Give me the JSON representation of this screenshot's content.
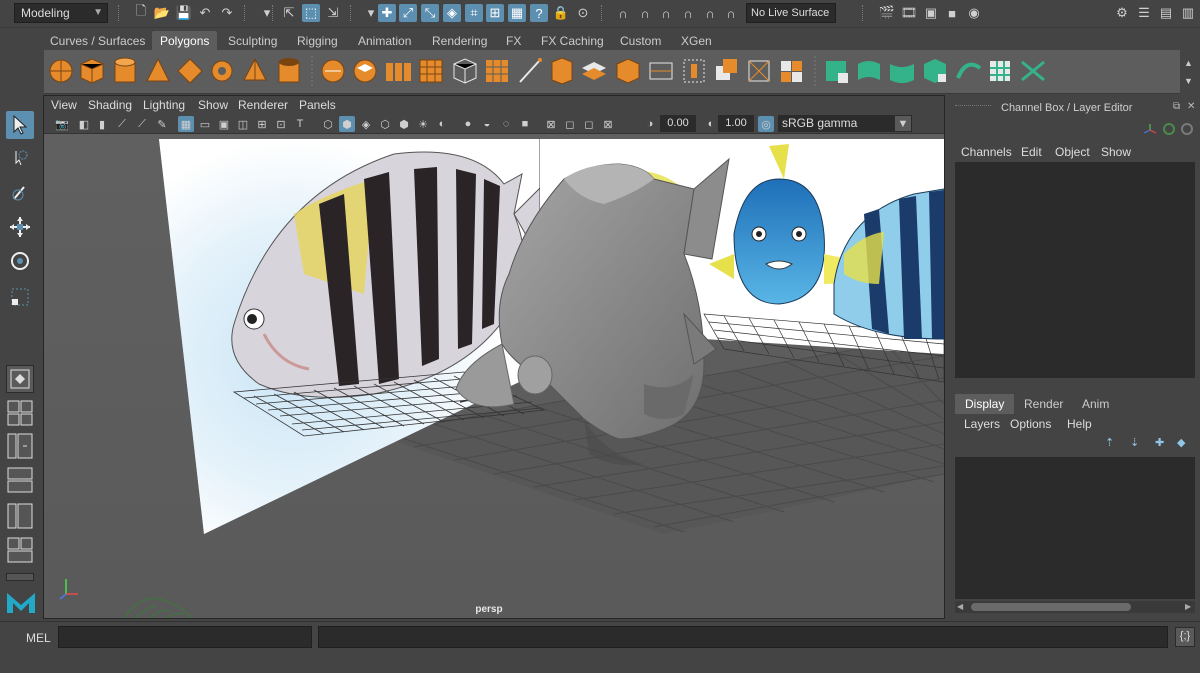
{
  "status_line": {
    "mode": "Modeling",
    "live_surface": "No Live Surface"
  },
  "shelf": {
    "tabs": [
      "Curves / Surfaces",
      "Polygons",
      "Sculpting",
      "Rigging",
      "Animation",
      "Rendering",
      "FX",
      "FX Caching",
      "Custom",
      "XGen"
    ],
    "active_tab": "Polygons"
  },
  "viewport": {
    "menus": [
      "View",
      "Shading",
      "Lighting",
      "Show",
      "Renderer",
      "Panels"
    ],
    "exposure": "0.00",
    "gamma": "1.00",
    "color_space": "sRGB gamma",
    "camera_label": "persp"
  },
  "channel_box": {
    "title": "Channel Box / Layer Editor",
    "menus": [
      "Channels",
      "Edit",
      "Object",
      "Show"
    ]
  },
  "layer_editor": {
    "tabs": [
      "Display",
      "Render",
      "Anim"
    ],
    "active_tab": "Display",
    "menus": [
      "Layers",
      "Options",
      "Help"
    ]
  },
  "command_line": {
    "label": "MEL",
    "input": ""
  },
  "colors": {
    "ui_background": "#444444",
    "panel_dark": "#2b2b2b",
    "highlight_blue": "#5d8fb0",
    "shelf_orange": "#e58b2b",
    "shelf_teal": "#34b38a"
  }
}
